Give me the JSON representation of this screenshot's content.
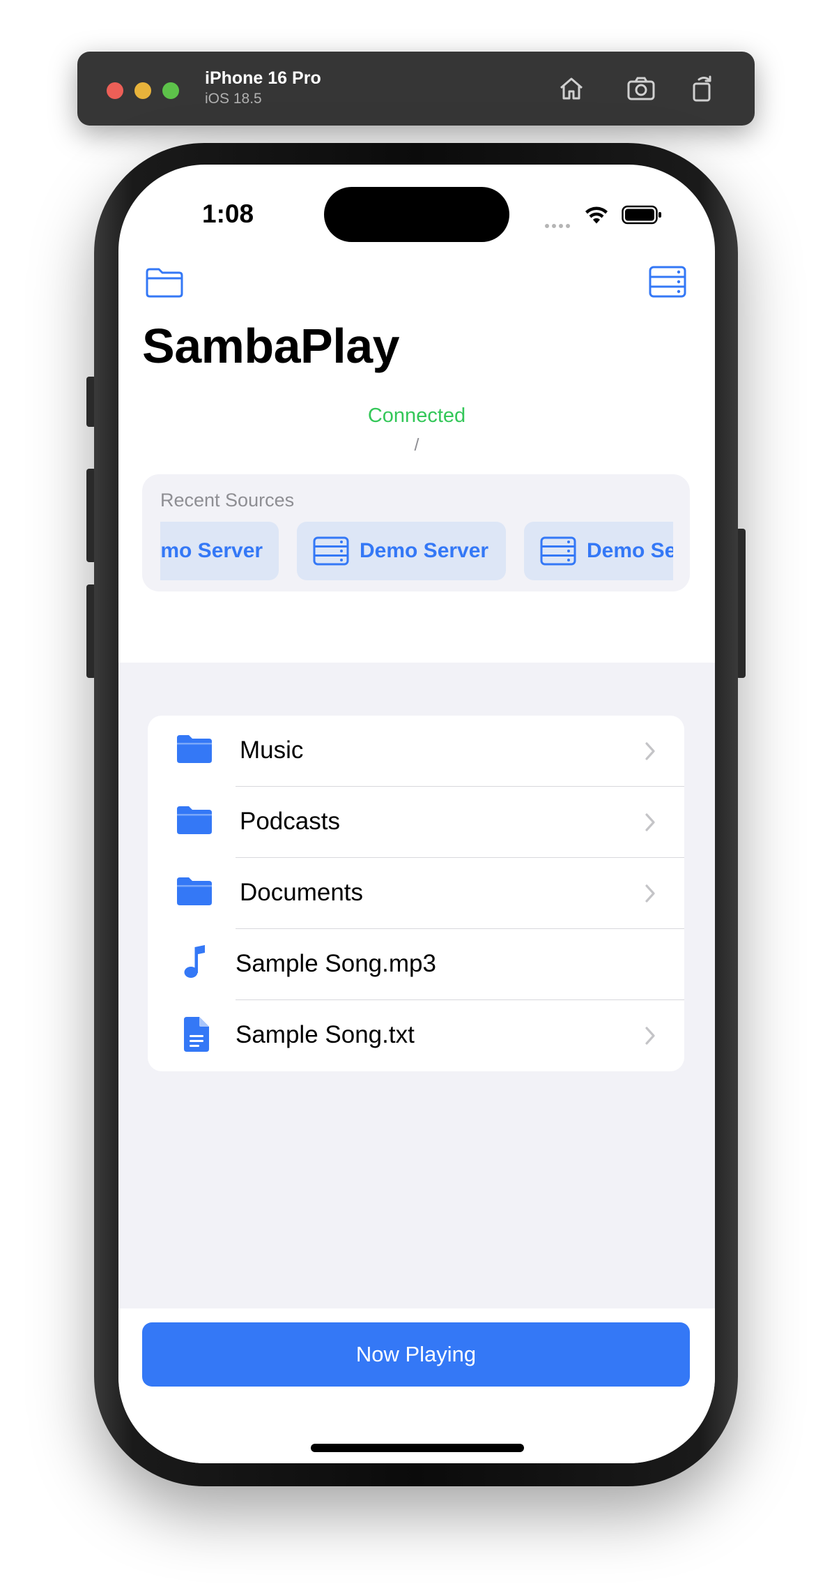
{
  "simulator": {
    "device_name": "iPhone 16 Pro",
    "os_version": "iOS 18.5",
    "buttons": [
      "home-icon",
      "screenshot-icon",
      "rotate-icon"
    ]
  },
  "status_bar": {
    "time": "1:08"
  },
  "app": {
    "title": "SambaPlay",
    "connection_status": "Connected",
    "current_path": "/",
    "accent_color": "#3478f6",
    "status_color": "#34c759"
  },
  "recent_sources": {
    "header": "Recent Sources",
    "items": [
      {
        "label": "Demo Server",
        "icon": "server-icon"
      },
      {
        "label": "Demo Server",
        "icon": "server-icon"
      },
      {
        "label": "Demo Server",
        "icon": "server-icon"
      }
    ]
  },
  "files": [
    {
      "name": "Music",
      "type": "folder",
      "icon": "folder-icon",
      "chevron": true
    },
    {
      "name": "Podcasts",
      "type": "folder",
      "icon": "folder-icon",
      "chevron": true
    },
    {
      "name": "Documents",
      "type": "folder",
      "icon": "folder-icon",
      "chevron": true
    },
    {
      "name": "Sample Song.mp3",
      "type": "audio",
      "icon": "music-note-icon",
      "chevron": false
    },
    {
      "name": "Sample Song.txt",
      "type": "text",
      "icon": "document-icon",
      "chevron": true
    }
  ],
  "bottom": {
    "now_playing_label": "Now Playing"
  }
}
